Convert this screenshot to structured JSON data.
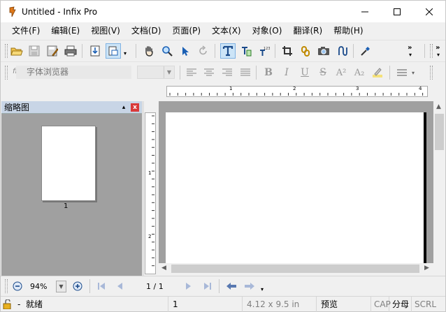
{
  "window": {
    "title": "Untitled - Infix Pro",
    "min_icon": "minimize-icon",
    "max_icon": "maximize-icon",
    "close_icon": "close-icon"
  },
  "menu": [
    {
      "label": "文件(F)"
    },
    {
      "label": "编辑(E)"
    },
    {
      "label": "视图(V)"
    },
    {
      "label": "文档(D)"
    },
    {
      "label": "页面(P)"
    },
    {
      "label": "文本(X)"
    },
    {
      "label": "对象(O)"
    },
    {
      "label": "翻译(R)"
    },
    {
      "label": "帮助(H)"
    }
  ],
  "format_toolbar": {
    "font_placeholder": "字体浏览器",
    "font_size": ""
  },
  "thumbnails": {
    "header": "缩略图",
    "pin": "▴",
    "close": "x",
    "page_number": "1"
  },
  "rulers": {
    "h_labels": [
      "1",
      "2",
      "3",
      "4"
    ],
    "v_labels": [
      "1",
      "2"
    ]
  },
  "navigation": {
    "zoom": "94%",
    "page_indicator": "1 / 1"
  },
  "status": {
    "state": "就绪",
    "dash": "-",
    "page": "1",
    "page_size": "4.12 x 9.5 in",
    "mode": "预览",
    "cap": "CAP",
    "ime": "分母",
    "scrl": "SCRL"
  },
  "colors": {
    "accent": "#cce4f7",
    "workspace": "#a0a0a0",
    "panel_header": "#c8d5e6",
    "close_red": "#d93a3a"
  }
}
